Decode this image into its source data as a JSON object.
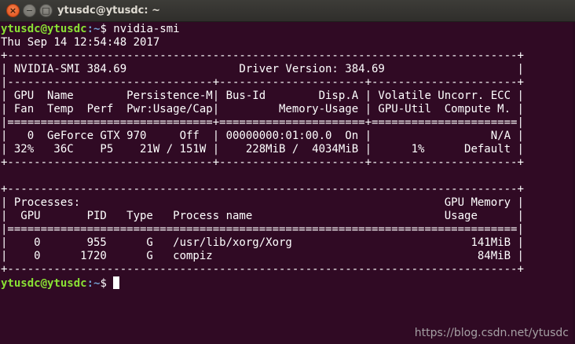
{
  "window": {
    "title": "ytusdc@ytusdc: ~",
    "close_glyph": "×",
    "minimize_glyph": "−",
    "maximize_glyph": "□"
  },
  "terminal": {
    "prompt1": {
      "user_host": "ytusdc@ytusdc",
      "path": ":~",
      "symbol": "$ ",
      "command": "nvidia-smi"
    },
    "output_lines": [
      "Thu Sep 14 12:54:48 2017",
      "+-----------------------------------------------------------------------------+",
      "| NVIDIA-SMI 384.69                 Driver Version: 384.69                    |",
      "|-------------------------------+----------------------+----------------------+",
      "| GPU  Name        Persistence-M| Bus-Id        Disp.A | Volatile Uncorr. ECC |",
      "| Fan  Temp  Perf  Pwr:Usage/Cap|         Memory-Usage | GPU-Util  Compute M. |",
      "|===============================+======================+======================|",
      "|   0  GeForce GTX 970     Off  | 00000000:01:00.0  On |                  N/A |",
      "| 32%   36C    P5    21W / 151W |    228MiB /  4034MiB |      1%      Default |",
      "+-------------------------------+----------------------+----------------------+",
      "",
      "+-----------------------------------------------------------------------------+",
      "| Processes:                                                       GPU Memory |",
      "|  GPU       PID   Type   Process name                             Usage      |",
      "|=============================================================================|",
      "|    0       955      G   /usr/lib/xorg/Xorg                           141MiB |",
      "|    0      1720      G   compiz                                        84MiB |",
      "+-----------------------------------------------------------------------------+"
    ],
    "prompt2": {
      "user_host": "ytusdc@ytusdc",
      "path": ":~",
      "symbol": "$ "
    }
  },
  "watermark": "https://blog.csdn.net/ytusdc",
  "colors": {
    "background": "#300a24",
    "text": "#ffffff",
    "prompt_user": "#8ae234",
    "prompt_path": "#729fcf",
    "close_button": "#df4a16"
  }
}
